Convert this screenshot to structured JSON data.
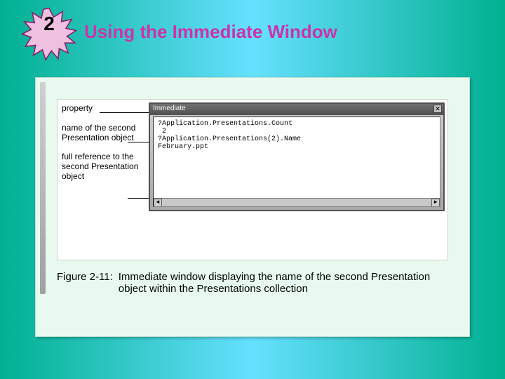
{
  "badge": {
    "number": "2"
  },
  "title": "Using the Immediate Window",
  "labels": {
    "l1": "property",
    "l2": "name of the second Presentation object",
    "l3": "full reference to the second Presentation object"
  },
  "immediate": {
    "title": "Immediate",
    "close": "✕",
    "lines": {
      "a": "?Application.Presentations.Count",
      "b": " 2",
      "c": "?Application.Presentations(2).Name",
      "d": "February.ppt",
      "e": ""
    },
    "scroll_left": "◄",
    "scroll_right": "►"
  },
  "caption": {
    "num": "Figure 2-11:",
    "text": "Immediate window displaying the name of the second Presentation object within the Presentations collection"
  }
}
